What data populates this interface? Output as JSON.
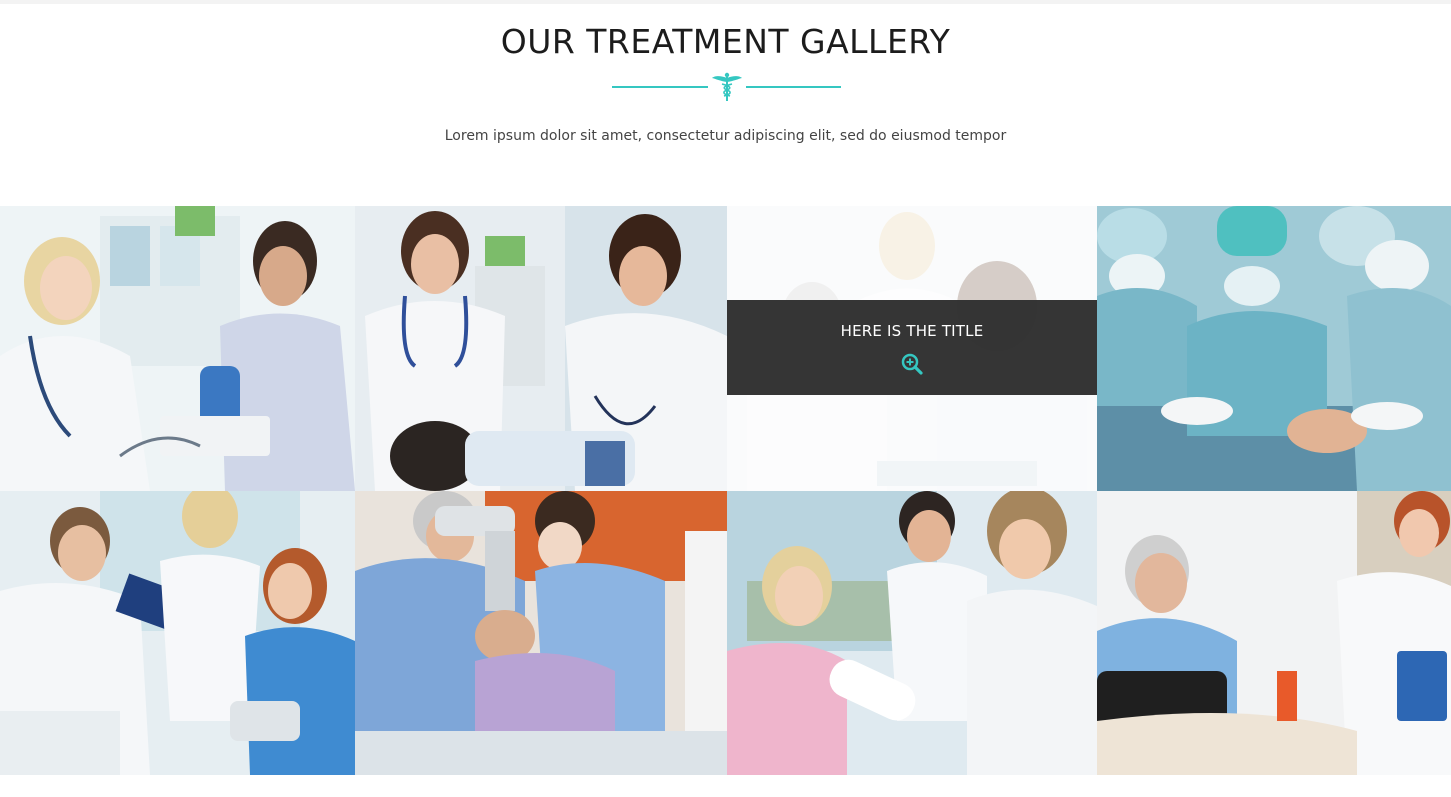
{
  "section": {
    "title": "OUR TREATMENT GALLERY",
    "subtitle": "Lorem ipsum dolor sit amet, consectetur adipiscing elit, sed do eiusmod tempor"
  },
  "gallery": {
    "hovered_overlay": {
      "title": "HERE IS THE TITLE",
      "icon": "zoom-in-icon"
    },
    "items": [
      {
        "scene": "doctor-measuring-blood-pressure"
      },
      {
        "scene": "nurses-with-patient-stethoscope"
      },
      {
        "scene": "doctors-consultation-highlighted"
      },
      {
        "scene": "surgical-team-operating"
      },
      {
        "scene": "doctor-and-nurses-with-clipboard"
      },
      {
        "scene": "dentist-treating-patient"
      },
      {
        "scene": "nurse-bandaging-arm"
      },
      {
        "scene": "doctor-with-elderly-patient"
      }
    ]
  },
  "colors": {
    "accent": "#35c7c1",
    "overlay": "#2e2e2e",
    "title": "#1c1c1c",
    "subtitle": "#444444"
  }
}
